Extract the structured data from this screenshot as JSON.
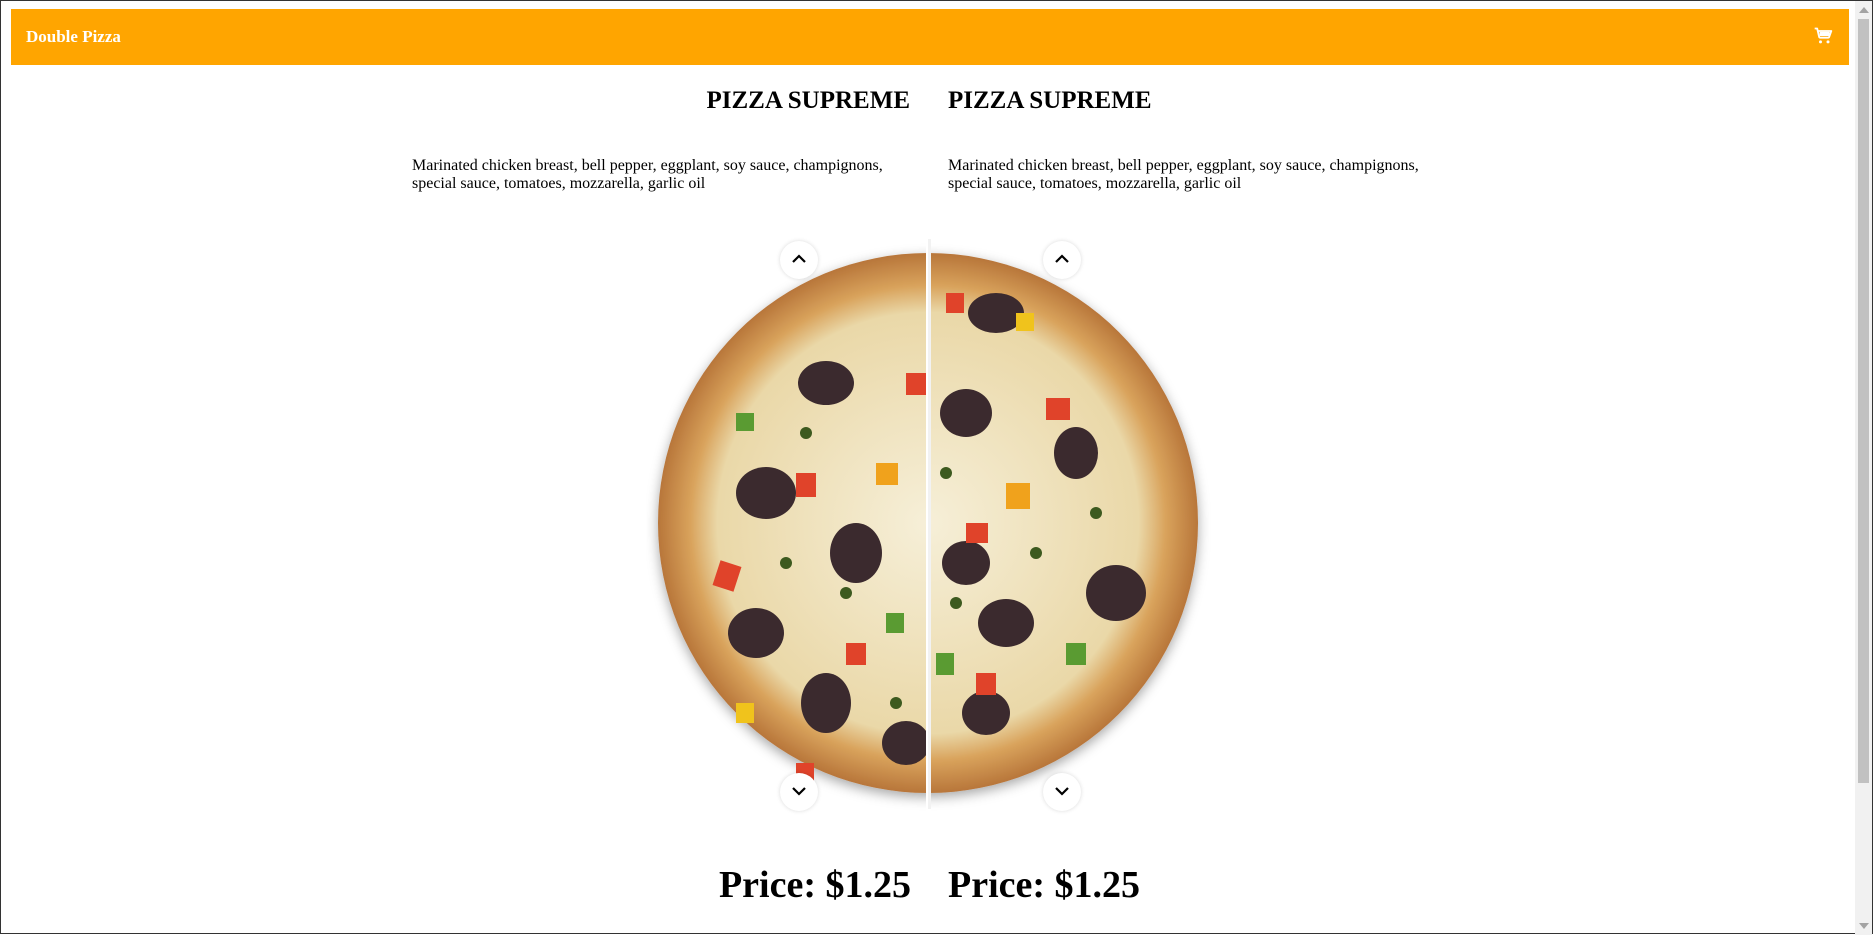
{
  "header": {
    "brand": "Double Pizza",
    "cart_icon": "cart-icon",
    "background_color": "#ffa500"
  },
  "left_pizza": {
    "name": "PIZZA SUPREME",
    "description": "Marinated chicken breast, bell pepper, eggplant, soy sauce, champignons, special sauce, tomatoes, mozzarella, garlic oil",
    "price": "Price: $1.25"
  },
  "right_pizza": {
    "name": "PIZZA SUPREME",
    "description": "Marinated chicken breast, bell pepper, eggplant, soy sauce, champignons, special sauce, tomatoes, mozzarella, garlic oil",
    "price": "Price: $1.25"
  },
  "controls": {
    "up_icon": "chevron-up-icon",
    "down_icon": "chevron-down-icon"
  }
}
